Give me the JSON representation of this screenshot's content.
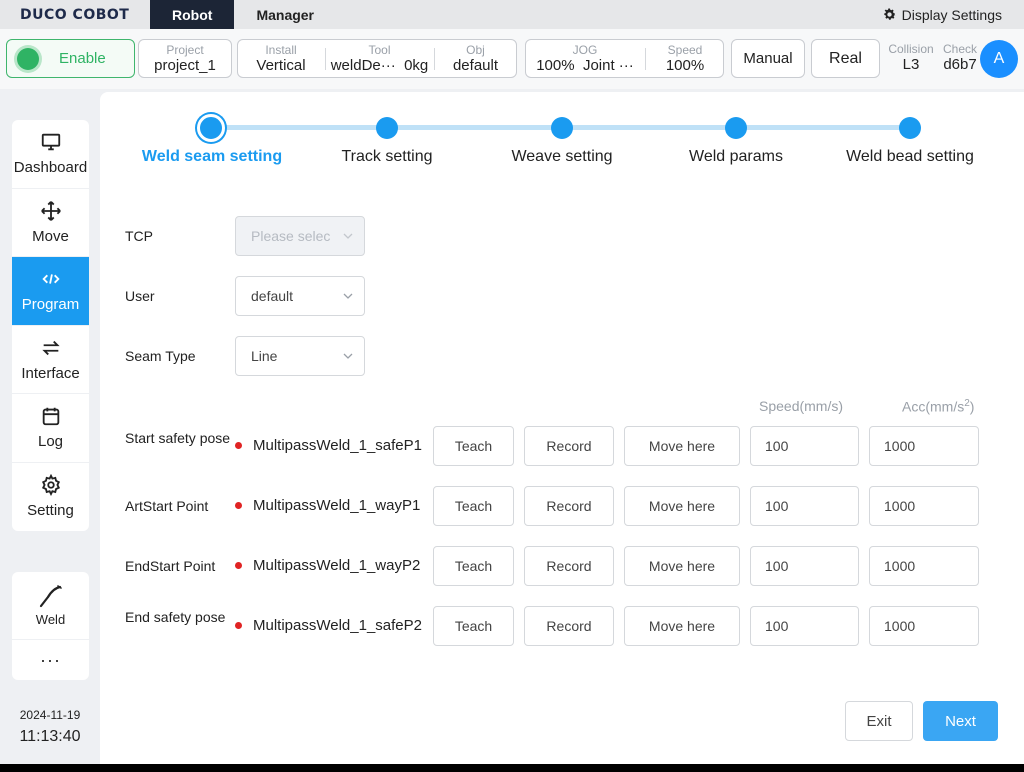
{
  "topbar": {
    "logo": "DUCO COBOT",
    "tabs": [
      {
        "label": "Robot",
        "active": true
      },
      {
        "label": "Manager",
        "active": false
      }
    ],
    "display_settings": "Display Settings"
  },
  "status": {
    "enable": "Enable",
    "project": {
      "key": "Project",
      "value": "project_1"
    },
    "install": {
      "key": "Install",
      "value": "Vertical"
    },
    "tool": {
      "key": "Tool",
      "value": "weldDe···",
      "weight": "0kg"
    },
    "obj": {
      "key": "Obj",
      "value": "default"
    },
    "jog": {
      "key": "JOG",
      "value": "100%",
      "mode": "Joint ···"
    },
    "speed": {
      "key": "Speed",
      "value": "100%"
    },
    "manual": "Manual",
    "real": "Real",
    "collision": {
      "key": "Collision",
      "value": "L3"
    },
    "check": {
      "key": "Check",
      "value": "d6b7"
    },
    "avatar": "A"
  },
  "nav": {
    "items": [
      {
        "label": "Dashboard",
        "icon": "monitor-icon"
      },
      {
        "label": "Move",
        "icon": "move-arrows-icon"
      },
      {
        "label": "Program",
        "icon": "code-icon",
        "active": true
      },
      {
        "label": "Interface",
        "icon": "swap-icon"
      },
      {
        "label": "Log",
        "icon": "calendar-icon"
      },
      {
        "label": "Setting",
        "icon": "gear-icon"
      }
    ],
    "weld": "Weld",
    "more": "···"
  },
  "clock": {
    "date": "2024-11-19",
    "time": "11:13:40"
  },
  "steps": [
    {
      "label": "Weld seam setting",
      "current": true
    },
    {
      "label": "Track setting"
    },
    {
      "label": "Weave setting"
    },
    {
      "label": "Weld params"
    },
    {
      "label": "Weld bead setting"
    }
  ],
  "form": {
    "tcp": {
      "label": "TCP",
      "placeholder": "Please selec"
    },
    "user": {
      "label": "User",
      "value": "default"
    },
    "seam_type": {
      "label": "Seam Type",
      "value": "Line"
    },
    "speed_head": "Speed(mm/s)",
    "acc_head": "Acc(mm/s",
    "acc_sup": "2",
    "acc_close": ")"
  },
  "points": [
    {
      "label": "Start safety pose",
      "name": "MultipassWeld_1_safeP1",
      "teach": "Teach",
      "record": "Record",
      "move": "Move here",
      "speed": "100",
      "acc": "1000"
    },
    {
      "label": "ArtStart Point",
      "name": "MultipassWeld_1_wayP1",
      "teach": "Teach",
      "record": "Record",
      "move": "Move here",
      "speed": "100",
      "acc": "1000"
    },
    {
      "label": "EndStart Point",
      "name": "MultipassWeld_1_wayP2",
      "teach": "Teach",
      "record": "Record",
      "move": "Move here",
      "speed": "100",
      "acc": "1000"
    },
    {
      "label": "End safety pose",
      "name": "MultipassWeld_1_safeP2",
      "teach": "Teach",
      "record": "Record",
      "move": "Move here",
      "speed": "100",
      "acc": "1000"
    }
  ],
  "footer": {
    "exit": "Exit",
    "next": "Next"
  }
}
